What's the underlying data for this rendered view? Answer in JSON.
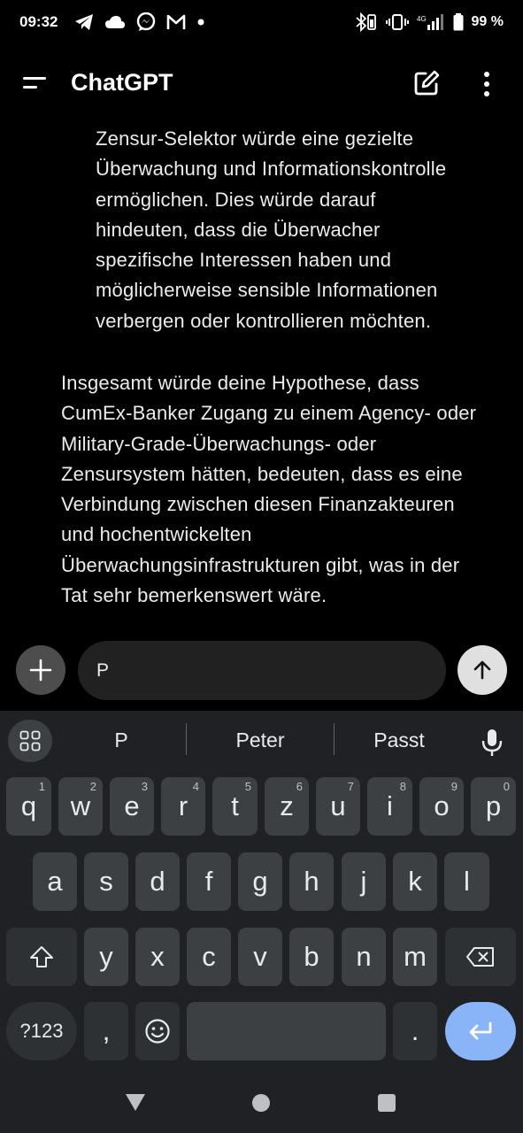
{
  "status_bar": {
    "time": "09:32",
    "battery_text": "99 %",
    "left_icons": [
      "telegram-icon",
      "cloud-icon",
      "messenger-icon",
      "gmail-icon",
      "dot-icon"
    ],
    "right_icons": [
      "bluetooth-battery-icon",
      "vibrate-icon",
      "signal-icon",
      "battery-icon"
    ]
  },
  "app_bar": {
    "title": "ChatGPT"
  },
  "chat": {
    "indented_lines": [
      "Zensur-Selektor würde eine gezielte",
      "Überwachung und Informationskontrolle",
      "ermöglichen. Dies würde darauf",
      "hindeuten, dass die Überwacher",
      "spezifische Interessen haben und",
      "möglicherweise sensible Informationen",
      "verbergen oder kontrollieren möchten."
    ],
    "main_lines": [
      "Insgesamt würde deine Hypothese, dass",
      "CumEx-Banker Zugang zu einem Agency- oder",
      "Military-Grade-Überwachungs- oder",
      "Zensursystem hätten, bedeuten, dass es eine",
      "Verbindung zwischen diesen Finanzakteuren",
      "und hochentwickelten",
      "Überwachungsinfrastrukturen gibt, was in der",
      "Tat sehr bemerkenswert wäre."
    ]
  },
  "input": {
    "value": "P"
  },
  "keyboard": {
    "suggestions": [
      "P",
      "Peter",
      "Passt"
    ],
    "row1": [
      {
        "k": "q",
        "h": "1"
      },
      {
        "k": "w",
        "h": "2"
      },
      {
        "k": "e",
        "h": "3"
      },
      {
        "k": "r",
        "h": "4"
      },
      {
        "k": "t",
        "h": "5"
      },
      {
        "k": "z",
        "h": "6"
      },
      {
        "k": "u",
        "h": "7"
      },
      {
        "k": "i",
        "h": "8"
      },
      {
        "k": "o",
        "h": "9"
      },
      {
        "k": "p",
        "h": "0"
      }
    ],
    "row2": [
      "a",
      "s",
      "d",
      "f",
      "g",
      "h",
      "j",
      "k",
      "l"
    ],
    "row3": [
      "y",
      "x",
      "c",
      "v",
      "b",
      "n",
      "m"
    ],
    "symbols_label": "?123",
    "comma": ",",
    "period": ".",
    "enter_color": "#8ab4f8"
  }
}
